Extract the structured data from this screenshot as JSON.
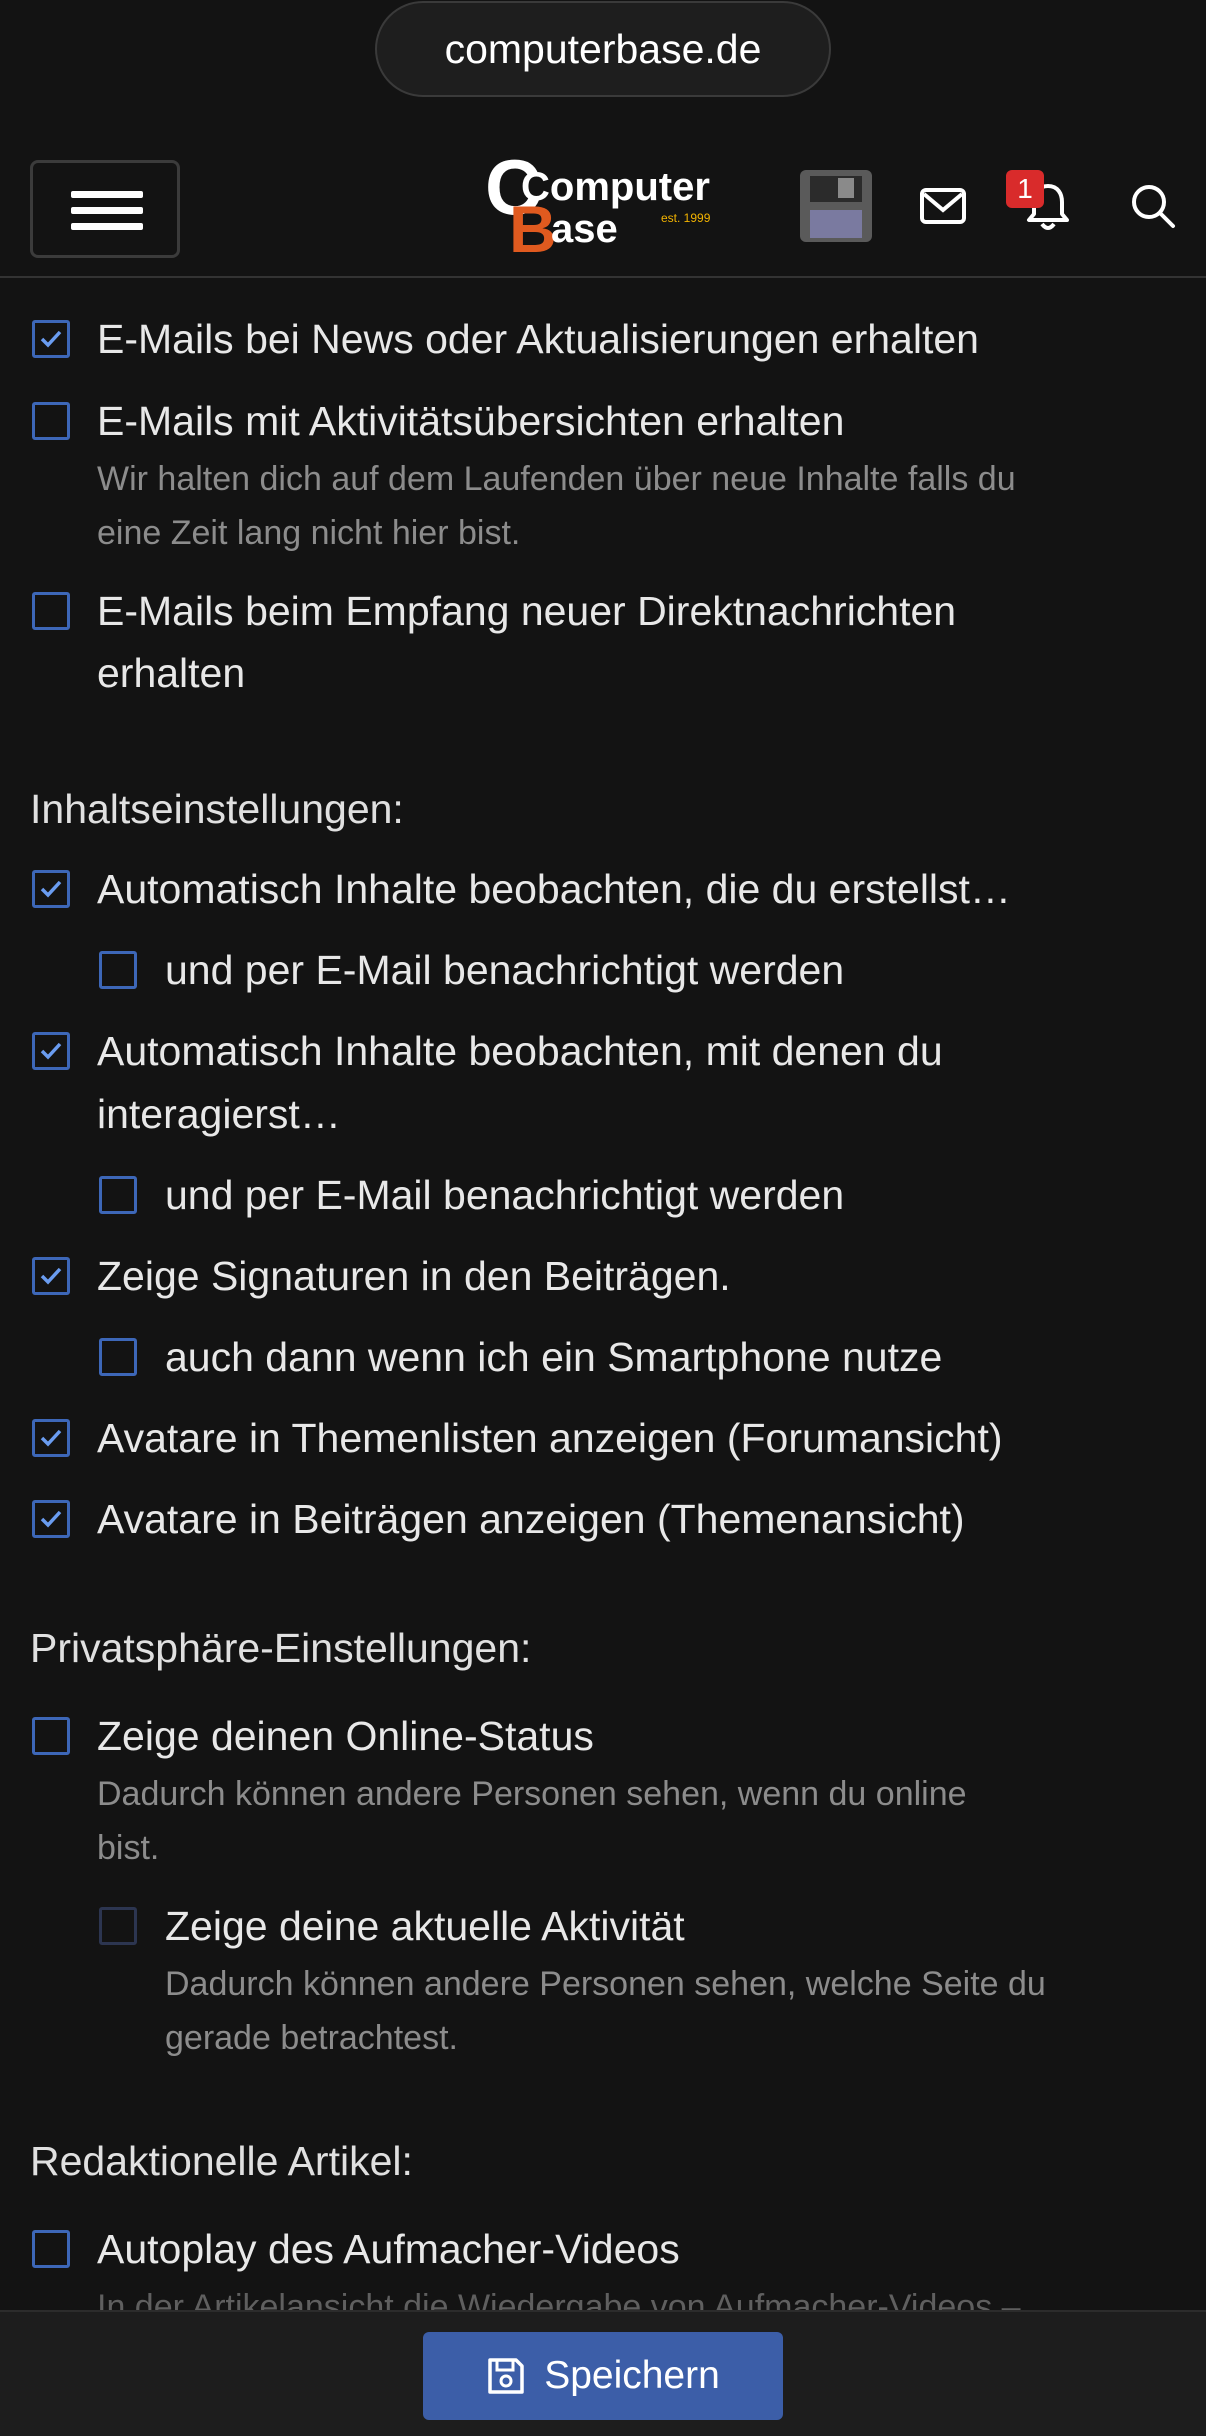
{
  "browser": {
    "url": "computerbase.de"
  },
  "header": {
    "logo_text_1": "Computer",
    "logo_text_2": "Base",
    "logo_est": "est. 1999",
    "notifications_count": "1",
    "icons": [
      "menu-icon",
      "avatar",
      "mail-icon",
      "bell-icon",
      "search-icon"
    ]
  },
  "email_settings": [
    {
      "label": "E-Mails bei News oder Aktualisierungen erhalten",
      "checked": true
    },
    {
      "label": "E-Mails mit Aktivitätsübersichten erhalten",
      "hint_1": "Wir halten dich auf dem Laufenden über neue Inhalte falls du",
      "hint_2": "eine Zeit lang nicht hier bist.",
      "checked": false
    },
    {
      "label_1": "E-Mails beim Empfang neuer Direktnachrichten",
      "label_2": "erhalten",
      "checked": false
    }
  ],
  "content_settings": {
    "title": "Inhaltseinstellungen:",
    "items": [
      {
        "label": "Automatisch Inhalte beobachten, die du erstellst…",
        "checked": true
      },
      {
        "label": "und per E-Mail benachrichtigt werden",
        "checked": false
      },
      {
        "label_1": "Automatisch Inhalte beobachten, mit denen du",
        "label_2": "interagierst…",
        "checked": true
      },
      {
        "label": "und per E-Mail benachrichtigt werden",
        "checked": false
      },
      {
        "label": "Zeige Signaturen in den Beiträgen.",
        "checked": true
      },
      {
        "label": "auch dann wenn ich ein Smartphone nutze",
        "checked": false
      },
      {
        "label": "Avatare in Themenlisten anzeigen (Forumansicht)",
        "checked": true
      },
      {
        "label": "Avatare in Beiträgen anzeigen (Themenansicht)",
        "checked": true
      }
    ]
  },
  "privacy_settings": {
    "title": "Privatsphäre-Einstellungen:",
    "items": [
      {
        "label": "Zeige deinen Online-Status",
        "hint_1": "Dadurch können andere Personen sehen, wenn du online",
        "hint_2": "bist.",
        "checked": false
      },
      {
        "label": "Zeige deine aktuelle Aktivität",
        "hint_1": "Dadurch können andere Personen sehen, welche Seite du",
        "hint_2": "gerade betrachtest.",
        "checked": false,
        "disabled": true
      }
    ]
  },
  "editorial_settings": {
    "title": "Redaktionelle Artikel:",
    "items": [
      {
        "label": "Autoplay des Aufmacher-Videos",
        "hint_1": "In der Artikelansicht die Wiedergabe von Aufmacher-Videos –",
        "checked": false
      }
    ]
  },
  "footer": {
    "save_label": "Speichern"
  },
  "colors": {
    "accent": "#3c5ea8",
    "checkbox_border": "#3d67b8",
    "badge": "#d92b2b",
    "background": "#131313"
  }
}
